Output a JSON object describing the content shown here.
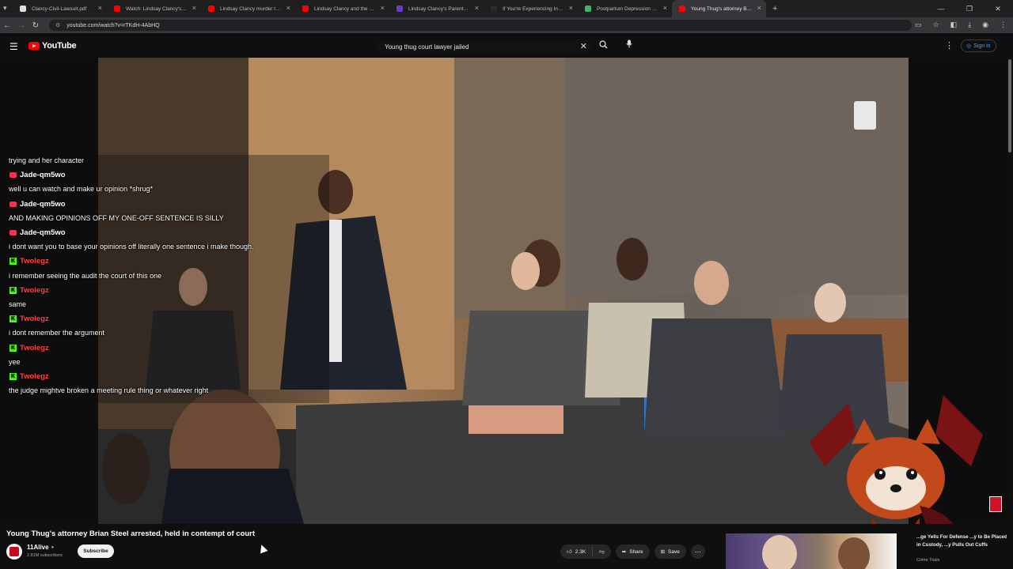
{
  "browser": {
    "tabs": [
      {
        "label": "Clancy-Civil-Lawsuit.pdf",
        "color": "#e0e0e0"
      },
      {
        "label": "Watch: Lindsay Clancy's defense",
        "color": "#ff0000"
      },
      {
        "label": "Lindsay Clancy murder trial: Pro",
        "color": "#ff0000"
      },
      {
        "label": "Lindsay Clancy and the Evidence",
        "color": "#ff0000"
      },
      {
        "label": "Lindsay Clancy's Parents' $1 Mi",
        "color": "#6b3cc9"
      },
      {
        "label": "If You're Experiencing Intrusive",
        "color": "#2a2a2a"
      },
      {
        "label": "Postpartum Depression (PPD)",
        "color": "#3db36b"
      },
      {
        "label": "Young Thug's attorney Brian",
        "color": "#ff0000"
      }
    ],
    "new_tab": "+",
    "url": "youtube.com/watch?v=rTKdH-4AbHQ"
  },
  "youtube": {
    "logo_text": "YouTube",
    "search_value": "Young thug court lawyer jailed",
    "sign_in": "Sign in"
  },
  "chat": [
    {
      "type": "text",
      "text": "trying and her character"
    },
    {
      "type": "user",
      "name": "Jade-qm5wo",
      "platform": "youtube"
    },
    {
      "type": "text",
      "text": "well u can watch and make ur opinion *shrug*"
    },
    {
      "type": "user",
      "name": "Jade-qm5wo",
      "platform": "youtube"
    },
    {
      "type": "text",
      "text": "AND MAKING OPINIONS OFF MY ONE-OFF SENTENCE IS SILLY"
    },
    {
      "type": "user",
      "name": "Jade-qm5wo",
      "platform": "youtube"
    },
    {
      "type": "text",
      "text": "i dont want you to base your opinions off literally one sentence i make though."
    },
    {
      "type": "user",
      "name": "Twolegz",
      "platform": "kick"
    },
    {
      "type": "text",
      "text": "i remember seeing the audit the court of this one"
    },
    {
      "type": "user",
      "name": "Twolegz",
      "platform": "kick"
    },
    {
      "type": "text",
      "text": "same"
    },
    {
      "type": "user",
      "name": "Twolegz",
      "platform": "kick"
    },
    {
      "type": "text",
      "text": "i dont remember the argument"
    },
    {
      "type": "user",
      "name": "Twolegz",
      "platform": "kick"
    },
    {
      "type": "text",
      "text": "yee"
    },
    {
      "type": "user",
      "name": "Twolegz",
      "platform": "kick"
    },
    {
      "type": "text",
      "text": "the judge mightve broken a meeting rule thing or whatever right"
    }
  ],
  "video": {
    "title": "Young Thug's attorney Brian Steel arrested, held in contempt of court",
    "channel": "11Alive",
    "subscribers": "2.81M subscribers",
    "subscribe_label": "Subscribe",
    "likes": "2.3K",
    "share_label": "Share",
    "save_label": "Save"
  },
  "recommended": {
    "title": "...ge Yells For Defense ...y to Be Placed in Custody, ...y Pulls Out Cuffs",
    "channel": "Crime Trials"
  }
}
